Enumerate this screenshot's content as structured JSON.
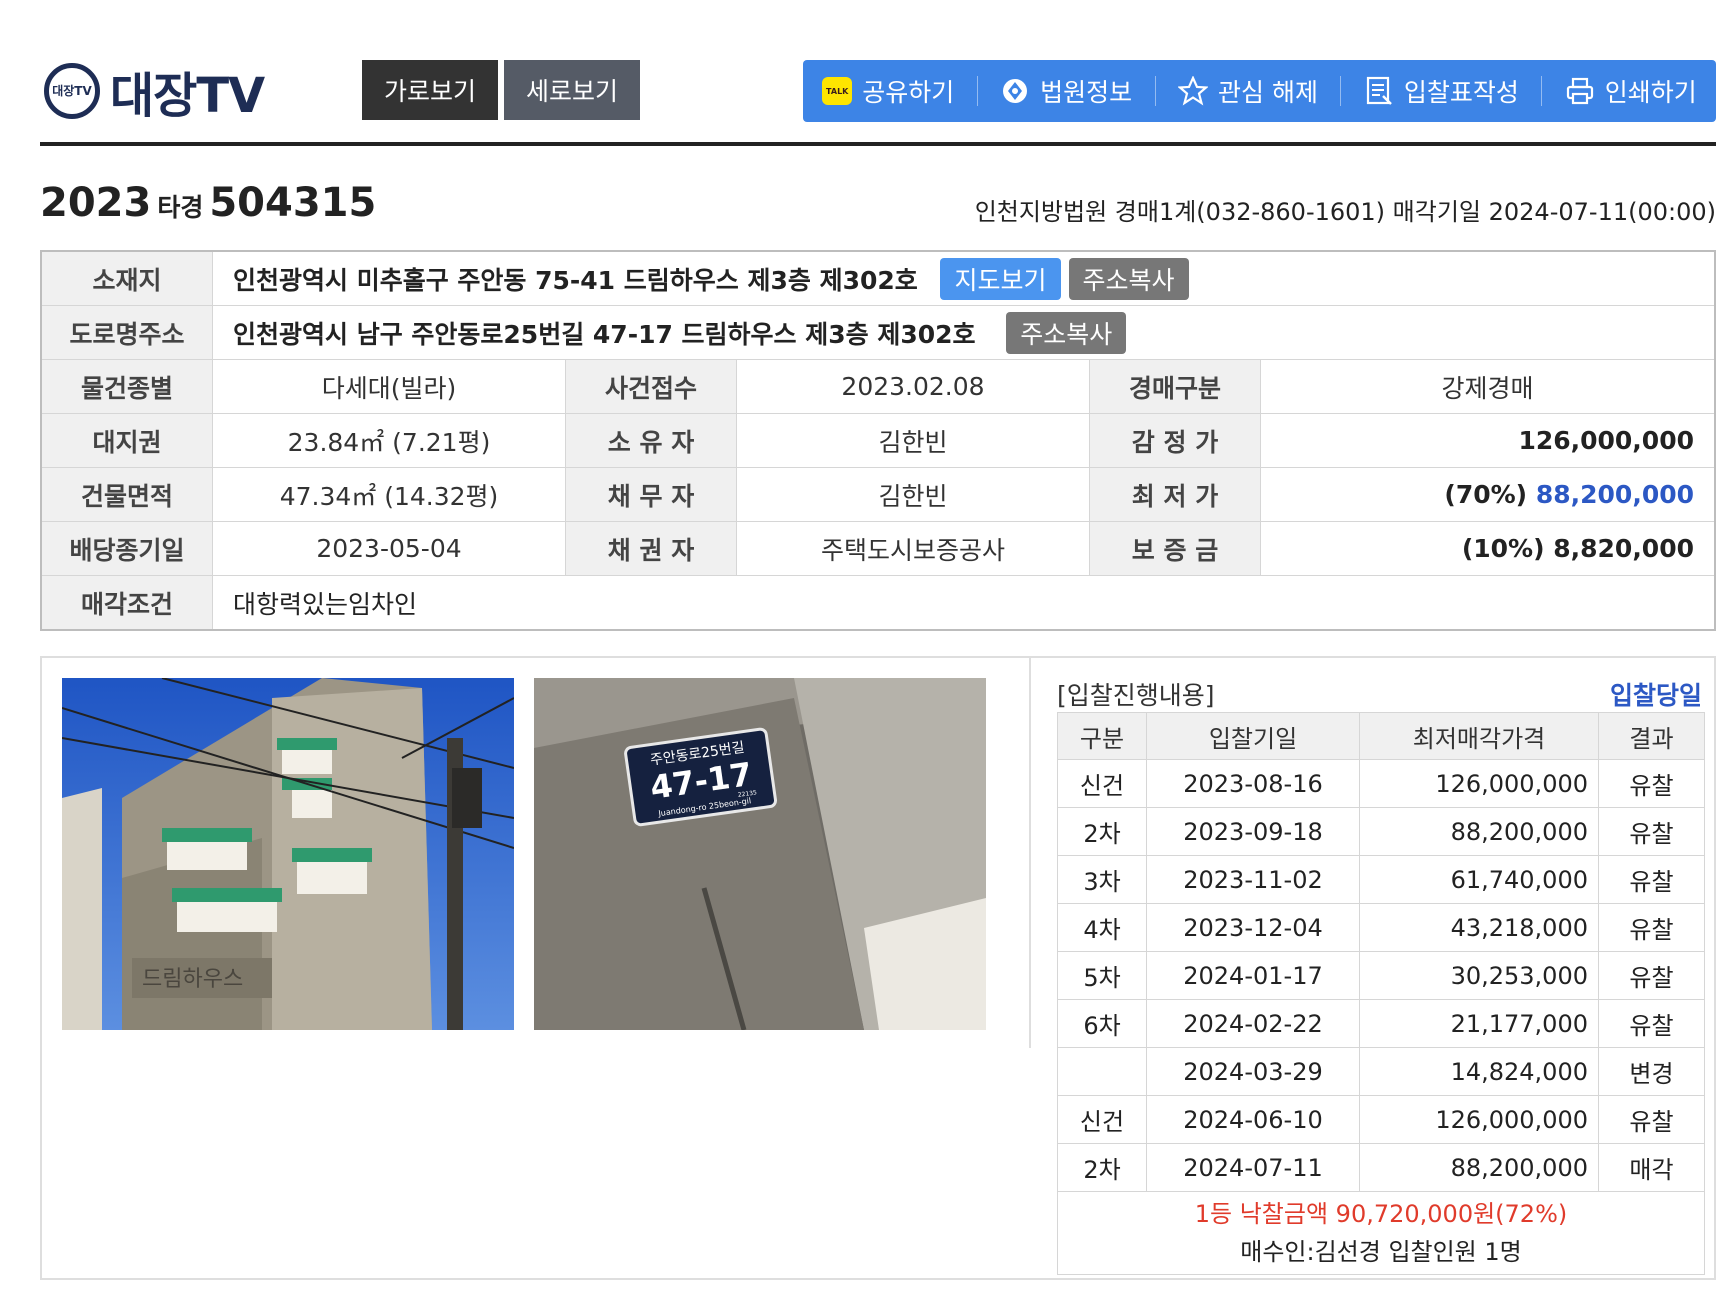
{
  "header": {
    "logo_badge": "대장TV",
    "logo_text": "대장TV",
    "view_tabs": [
      "가로보기",
      "세로보기"
    ],
    "toolbar": [
      {
        "label": "공유하기",
        "icon": "kakaotalk-icon"
      },
      {
        "label": "법원정보",
        "icon": "court-icon"
      },
      {
        "label": "관심 해제",
        "icon": "star-icon"
      },
      {
        "label": "입찰표작성",
        "icon": "document-icon"
      },
      {
        "label": "인쇄하기",
        "icon": "printer-icon"
      }
    ],
    "talk_text": "TALK"
  },
  "case": {
    "year": "2023",
    "type": "타경",
    "number": "504315",
    "court_info": "인천지방법원 경매1계(032-860-1601) 매각기일 2024-07-11(00:00)"
  },
  "info": {
    "location_label": "소재지",
    "location": "인천광역시 미추홀구 주안동 75-41 드림하우스 제3층 제302호",
    "map_button": "지도보기",
    "copy_button": "주소복사",
    "road_label": "도로명주소",
    "road": "인천광역시 남구 주안동로25번길 47-17 드림하우스 제3층 제302호",
    "rows": [
      [
        "물건종별",
        "다세대(빌라)",
        "사건접수",
        "2023.02.08",
        "경매구분",
        "강제경매"
      ],
      [
        "대지권",
        "23.84㎡ (7.21평)",
        "소 유 자",
        "김한빈",
        "감 정 가",
        "126,000,000"
      ],
      [
        "건물면적",
        "47.34㎡ (14.32평)",
        "채 무 자",
        "김한빈",
        "최 저 가",
        ""
      ],
      [
        "배당종기일",
        "2023-05-04",
        "채 권 자",
        "주택도시보증공사",
        "보 증 금",
        "(10%) 8,820,000"
      ]
    ],
    "min_price_pct": "(70%)",
    "min_price_value": "88,200,000",
    "condition_label": "매각조건",
    "condition": "대항력있는임차인"
  },
  "photos": {
    "sign_top": "주안동로25번길",
    "sign_number": "47-17",
    "sign_small": "22135",
    "sign_bottom": "Juandong-ro 25beon-gil",
    "building_sign": "드림하우스"
  },
  "bids": {
    "title": "[입찰진행내용]",
    "today_link": "입찰당일",
    "headers": [
      "구분",
      "입찰기일",
      "최저매각가격",
      "결과"
    ],
    "rows": [
      {
        "round": "신건",
        "date": "2023-08-16",
        "price": "126,000,000",
        "result": "유찰"
      },
      {
        "round": "2차",
        "date": "2023-09-18",
        "price": "88,200,000",
        "result": "유찰"
      },
      {
        "round": "3차",
        "date": "2023-11-02",
        "price": "61,740,000",
        "result": "유찰"
      },
      {
        "round": "4차",
        "date": "2023-12-04",
        "price": "43,218,000",
        "result": "유찰"
      },
      {
        "round": "5차",
        "date": "2024-01-17",
        "price": "30,253,000",
        "result": "유찰"
      },
      {
        "round": "6차",
        "date": "2024-02-22",
        "price": "21,177,000",
        "result": "유찰"
      },
      {
        "round": "",
        "date": "2024-03-29",
        "price": "14,824,000",
        "result": "변경"
      },
      {
        "round": "신건",
        "date": "2024-06-10",
        "price": "126,000,000",
        "result": "유찰"
      },
      {
        "round": "2차",
        "date": "2024-07-11",
        "price": "88,200,000",
        "result": "매각"
      }
    ],
    "winning_bid": "1등 낙찰금액 90,720,000원(72%)",
    "buyer": "매수인:김선경 입찰인원 1명"
  },
  "colors": {
    "toolbar": "#3d84e6",
    "accent_red": "#e03b2b",
    "accent_blue": "#2c58c4"
  }
}
